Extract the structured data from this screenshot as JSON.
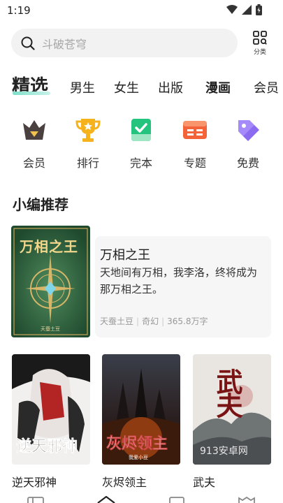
{
  "status": {
    "time": "1:19"
  },
  "search": {
    "placeholder": "斗破苍穹"
  },
  "category": {
    "label": "分类"
  },
  "tabs": [
    {
      "label": "精选",
      "active": true
    },
    {
      "label": "男生"
    },
    {
      "label": "女生"
    },
    {
      "label": "出版"
    },
    {
      "label": "漫画"
    },
    {
      "label": "会员"
    }
  ],
  "quick_links": [
    {
      "label": "会员",
      "icon": "crown-icon"
    },
    {
      "label": "排行",
      "icon": "trophy-icon"
    },
    {
      "label": "完本",
      "icon": "check-book-icon"
    },
    {
      "label": "专题",
      "icon": "topic-icon"
    },
    {
      "label": "免费",
      "icon": "tag-icon"
    }
  ],
  "section": {
    "title": "小编推荐"
  },
  "featured": {
    "title": "万相之王",
    "cover_title": "万相之王",
    "cover_author": "天蚕土豆",
    "description": "天地间有万相，我李洛，终将成为那万相之王。",
    "author": "天蚕土豆",
    "genre": "奇幻",
    "words": "365.8万字"
  },
  "books": [
    {
      "title": "逆天邪神",
      "cover_text": "逆天邪神"
    },
    {
      "title": "灰烬领主",
      "cover_text": "灰烬领主",
      "cover_author": "我爱小豆"
    },
    {
      "title": "武夫",
      "cover_text": "武夫",
      "watermark": "913安卓网"
    }
  ],
  "colors": {
    "accent": "#3ecfae",
    "crown": "#4a4040",
    "trophy": "#f5b21d",
    "complete": "#24c47e",
    "topic": "#f4623a",
    "free": "#8b6cf0"
  }
}
